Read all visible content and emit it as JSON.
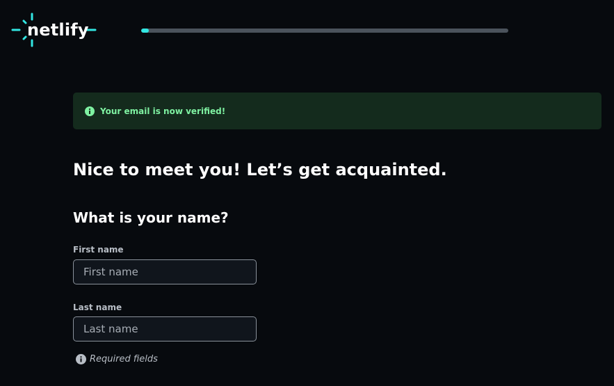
{
  "brand": {
    "logo_text": "netlify",
    "accent_color": "#32e6e2"
  },
  "progress": {
    "fraction": 0.02
  },
  "banner": {
    "icon": "info-icon",
    "text": "Your email is now verified!",
    "text_color": "#7ff2a2",
    "background": "#142b1d"
  },
  "main": {
    "title": "Nice to meet you! Let’s get acquainted.",
    "subtitle": "What is your name?"
  },
  "form": {
    "first_name": {
      "label": "First name",
      "placeholder": "First name",
      "value": ""
    },
    "last_name": {
      "label": "Last name",
      "placeholder": "Last name",
      "value": ""
    },
    "required_note": {
      "icon": "info-icon",
      "text": "Required fields"
    }
  }
}
